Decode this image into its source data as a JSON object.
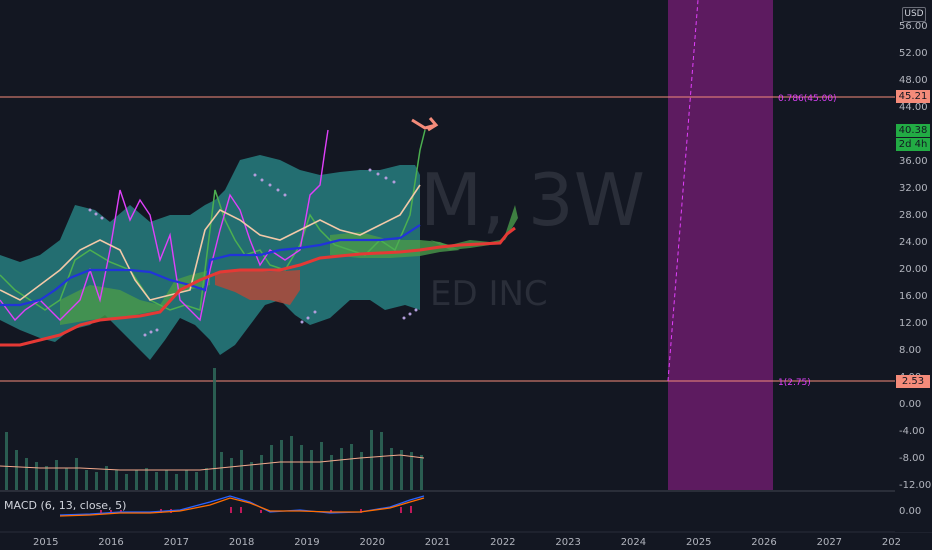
{
  "watermark": {
    "symbol": "M, 3W",
    "name": "ED INC"
  },
  "currency_label": "USD",
  "price_axis": {
    "ticks": [
      "56.00",
      "52.00",
      "48.00",
      "44.00",
      "40.00",
      "36.00",
      "32.00",
      "28.00",
      "24.00",
      "20.00",
      "16.00",
      "12.00",
      "8.00",
      "4.00",
      "0.00",
      "-4.00",
      "-8.00",
      "-12.00"
    ],
    "macd_tick": "0.00"
  },
  "time_axis": {
    "ticks": [
      "2015",
      "2016",
      "2017",
      "2018",
      "2019",
      "2020",
      "2021",
      "2022",
      "2023",
      "2024",
      "2025",
      "2026",
      "2027",
      "202"
    ]
  },
  "price_tags": {
    "upper_level": {
      "text": "45.21",
      "color": "#f48b7a"
    },
    "last_price": {
      "text": "40.38",
      "color": "#22ab44"
    },
    "countdown": {
      "text": "2d 4h",
      "color": "#22ab44"
    },
    "lower_level": {
      "text": "2.53",
      "color": "#f48b7a"
    }
  },
  "fib_labels": {
    "upper": "0.786(45.00)",
    "lower": "1(2.75)"
  },
  "macd": {
    "label": "MACD (6, 13, close, 5)"
  },
  "colors": {
    "background": "#131722",
    "cloud": "#2a8c8c",
    "kumo_bull": "#4a9a4a",
    "kumo_bear": "#b04a3a",
    "kijun": "#e53935",
    "tenkan": "#2134d9",
    "price": "#4caf50",
    "osc": "#e040fb",
    "highlight_zone": "#6b1c6b",
    "level_line": "#f48b7a"
  }
}
